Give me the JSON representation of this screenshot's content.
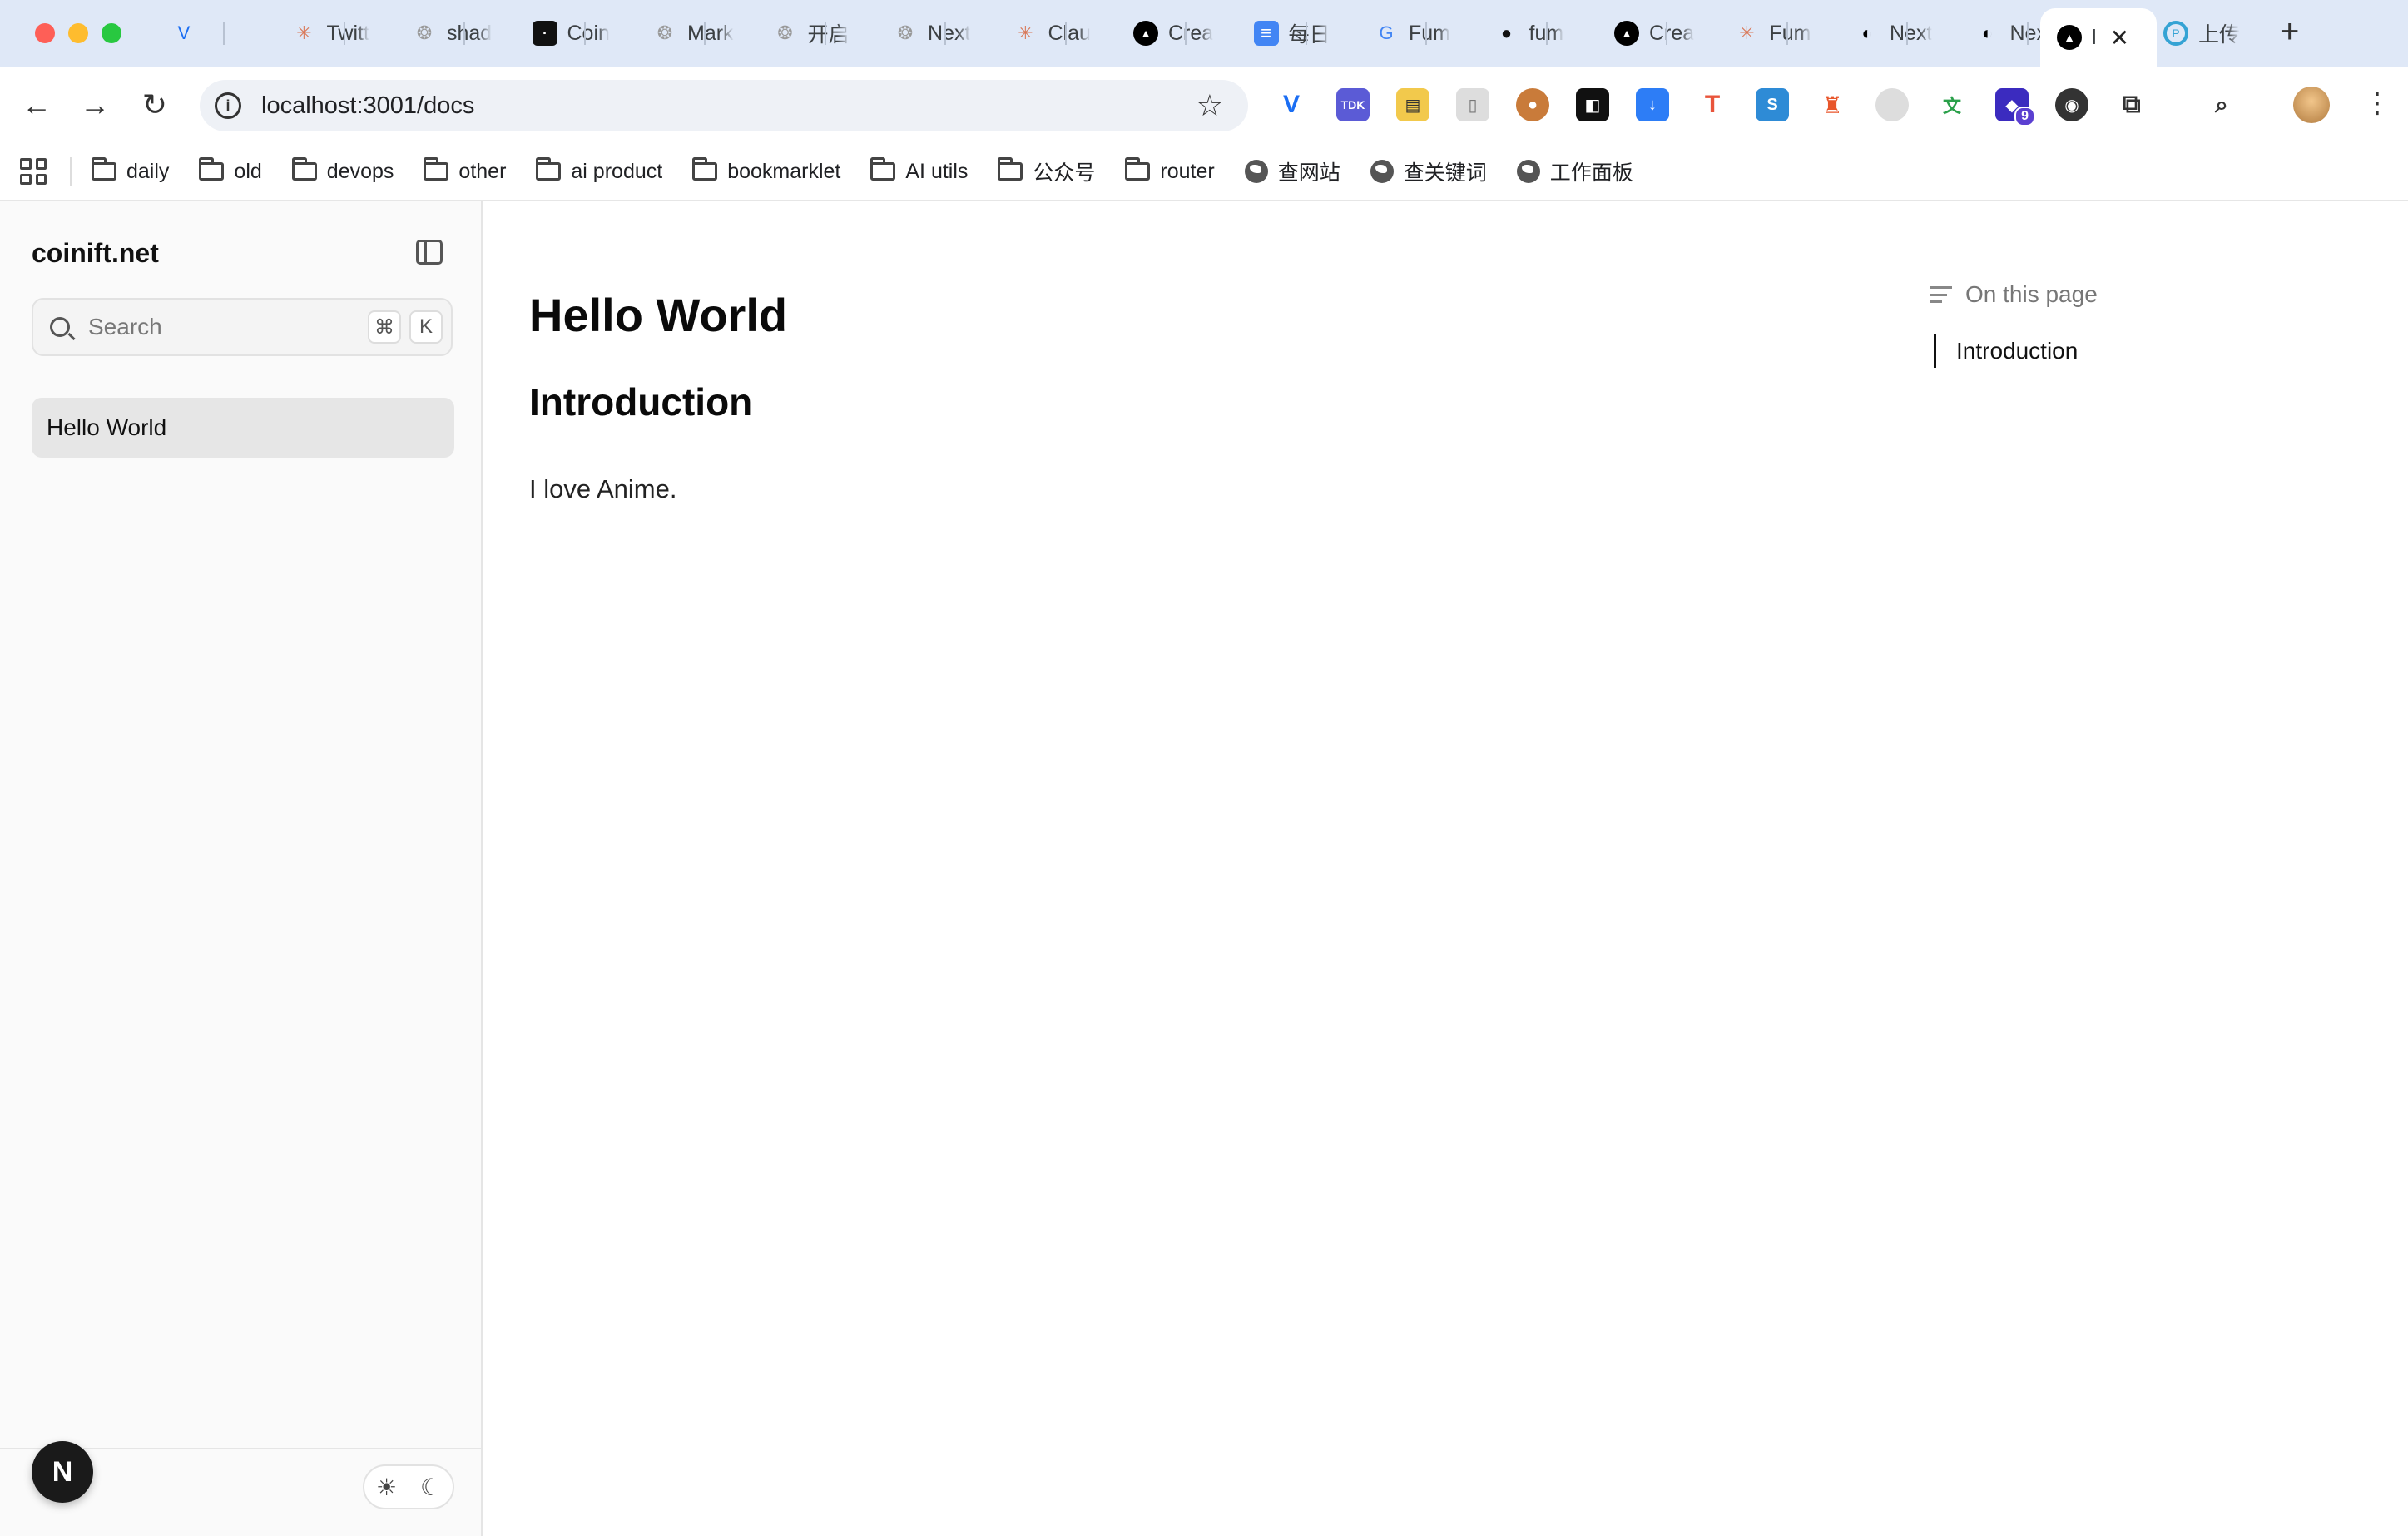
{
  "browser": {
    "tabs": [
      {
        "title": "",
        "icon": "vue-v-icon",
        "color": "#1b6ef3"
      },
      {
        "title": "Twitt",
        "icon": "claude-star-icon",
        "color": "#d97757"
      },
      {
        "title": "shad",
        "icon": "openai-icon",
        "color": "#999999"
      },
      {
        "title": "Coin",
        "icon": "coin-icon",
        "color": "#111111"
      },
      {
        "title": "Mark",
        "icon": "openai-icon",
        "color": "#999999"
      },
      {
        "title": "开启",
        "icon": "openai-icon",
        "color": "#999999"
      },
      {
        "title": "Next",
        "icon": "openai-icon",
        "color": "#999999"
      },
      {
        "title": "Clau",
        "icon": "claude-star-icon",
        "color": "#d97757"
      },
      {
        "title": "Crea",
        "icon": "triangle-icon",
        "color": "#000000"
      },
      {
        "title": "每日",
        "icon": "docs-icon",
        "color": "#4285f4"
      },
      {
        "title": "Fum",
        "icon": "google-icon",
        "color": "#4285f4"
      },
      {
        "title": "fum",
        "icon": "github-icon",
        "color": "#111111"
      },
      {
        "title": "Crea",
        "icon": "triangle-icon",
        "color": "#000000"
      },
      {
        "title": "Fum",
        "icon": "claude-star-icon",
        "color": "#d97757"
      },
      {
        "title": "Next",
        "icon": "nextjs-icon",
        "color": "#000000"
      },
      {
        "title": "Next",
        "icon": "nextjs-icon",
        "color": "#000000"
      }
    ],
    "active_tab": {
      "title": "l",
      "icon": "triangle-icon",
      "close": "✕"
    },
    "last_tab": {
      "title": "上传",
      "icon": "upload-icon"
    },
    "new_tab": "+",
    "url": "localhost:3001/docs",
    "extension_badge": "9",
    "bookmarks": [
      {
        "label": "daily",
        "type": "folder"
      },
      {
        "label": "old",
        "type": "folder"
      },
      {
        "label": "devops",
        "type": "folder"
      },
      {
        "label": "other",
        "type": "folder"
      },
      {
        "label": "ai product",
        "type": "folder"
      },
      {
        "label": "bookmarklet",
        "type": "folder"
      },
      {
        "label": "AI utils",
        "type": "folder"
      },
      {
        "label": "公众号",
        "type": "folder"
      },
      {
        "label": "router",
        "type": "folder"
      },
      {
        "label": "查网站",
        "type": "globe"
      },
      {
        "label": "查关键词",
        "type": "globe"
      },
      {
        "label": "工作面板",
        "type": "globe"
      }
    ]
  },
  "sidebar": {
    "site_title": "coinift.net",
    "search_placeholder": "Search",
    "search_shortcut_mod": "⌘",
    "search_shortcut_key": "K",
    "items": [
      {
        "label": "Hello World",
        "active": true
      }
    ],
    "avatar_letter": "N",
    "theme_light_icon": "☀",
    "theme_dark_icon": "☾"
  },
  "main": {
    "title": "Hello World",
    "heading": "Introduction",
    "paragraph": "I love Anime."
  },
  "toc": {
    "heading": "On this page",
    "items": [
      "Introduction"
    ]
  }
}
